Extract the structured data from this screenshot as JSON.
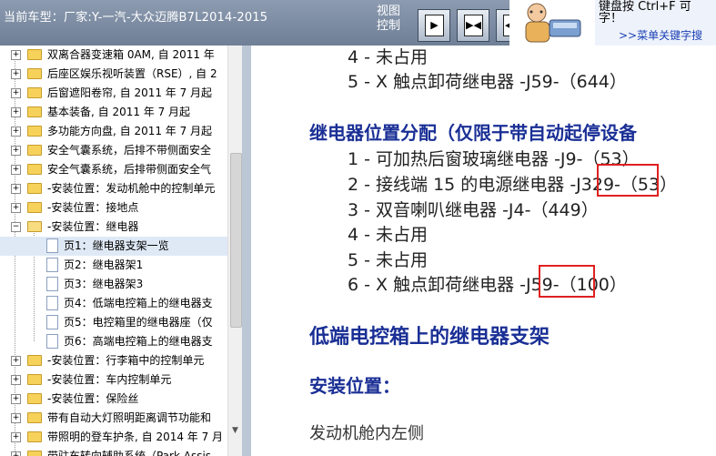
{
  "header": {
    "car_model": "当前车型：厂家:Y-一汽-大众迈腾B7L2014-2015",
    "view_control": "视图控制",
    "buttons": [
      "▶",
      "▶◀",
      "◀▶",
      "◀"
    ]
  },
  "help": {
    "line1": "键盘按 Ctrl+F 可",
    "line2": "字！",
    "link": ">>菜单关键字搜"
  },
  "tree": {
    "items": [
      {
        "label": "双离合器变速箱 0AM, 自 2011 年"
      },
      {
        "label": "后座区娱乐视听装置（RSE）, 自 2"
      },
      {
        "label": "后窗遮阳卷帘, 自 2011 年 7 月起"
      },
      {
        "label": "基本装备, 自 2011 年 7 月起"
      },
      {
        "label": "多功能方向盘, 自 2011 年 7 月起"
      },
      {
        "label": "安全气囊系统，后排不带侧面安全"
      },
      {
        "label": "安全气囊系统，后排带侧面安全气"
      },
      {
        "label": "-安装位置：发动机舱中的控制单元"
      },
      {
        "label": "-安装位置：接地点"
      },
      {
        "label": "-安装位置：继电器"
      },
      {
        "label": "页1：继电器支架一览"
      },
      {
        "label": "页2：继电器架1"
      },
      {
        "label": "页3：继电器架3"
      },
      {
        "label": "页4：低端电控箱上的继电器支"
      },
      {
        "label": "页5：电控箱里的继电器座（仅"
      },
      {
        "label": "页6：高端电控箱上的继电器支"
      },
      {
        "label": "-安装位置：行李箱中的控制单元"
      },
      {
        "label": "-安装位置：车内控制单元"
      },
      {
        "label": "-安装位置：保险丝"
      },
      {
        "label": "带有自动大灯照明距离调节功能和"
      },
      {
        "label": "带照明的登车护条, 自 2014 年 7 月"
      },
      {
        "label": "带驻车转向辅助系统（Park Assis"
      }
    ]
  },
  "content": {
    "top_item4": "4 - 未占用",
    "top_item5": "5 - X 触点卸荷继电器 -J59-（644）",
    "section_title": "继电器位置分配（仅限于带自动起停设备",
    "items": [
      "1 - 可加热后窗玻璃继电器 -J9-（53）",
      "2 - 接线端 15 的电源继电器 -J329-（53）",
      "3 - 双音喇叭继电器 -J4-（449）",
      "4 - 未占用",
      "5 - 未占用",
      "6 - X 触点卸荷继电器 -J59-（100）"
    ],
    "heading2": "低端电控箱上的继电器支架",
    "sub_heading": "安装位置：",
    "location": "发动机舱内左侧"
  },
  "colors": {
    "header_bg": "#7d8ca3",
    "heading": "#1a2f95",
    "highlight_box": "#e02020",
    "selected_row": "#dfe9f6"
  }
}
